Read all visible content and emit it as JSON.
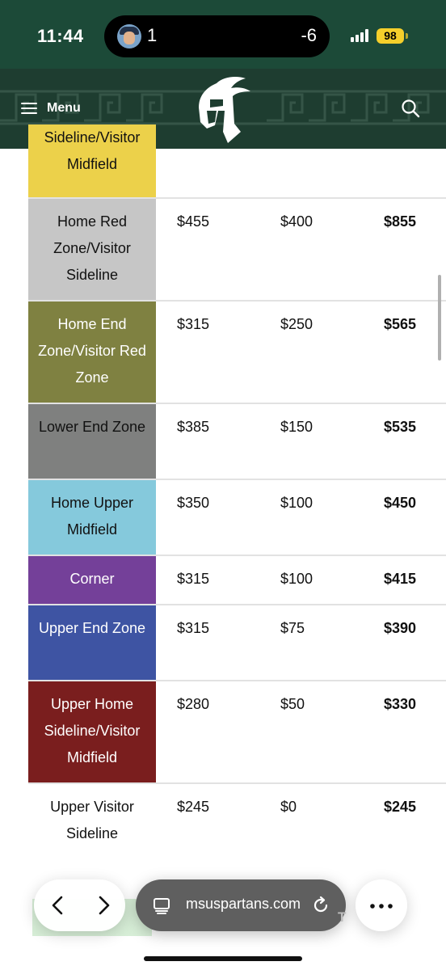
{
  "status_bar": {
    "time": "11:44",
    "live_activity_left": "1",
    "live_activity_right": "-6",
    "battery": "98"
  },
  "header": {
    "menu_label": "Menu",
    "logo": "spartan-helmet-logo",
    "search_icon": "search-icon",
    "background_color": "#1e3d30"
  },
  "price_table": {
    "rows": [
      {
        "zone": "Sideline/Visitor Midfield",
        "color": "#ecd14a",
        "text_color": "#111111",
        "price_a": "",
        "price_b": "",
        "total": ""
      },
      {
        "zone": "Home Red Zone/Visitor Sideline",
        "color": "#c6c6c6",
        "text_color": "#111111",
        "price_a": "$455",
        "price_b": "$400",
        "total": "$855"
      },
      {
        "zone": "Home End Zone/Visitor Red Zone",
        "color": "#7f8141",
        "text_color": "#ffffff",
        "price_a": "$315",
        "price_b": "$250",
        "total": "$565"
      },
      {
        "zone": "Lower End Zone",
        "color": "#7f807f",
        "text_color": "#111111",
        "price_a": "$385",
        "price_b": "$150",
        "total": "$535"
      },
      {
        "zone": "Home Upper Midfield",
        "color": "#85c9dc",
        "text_color": "#111111",
        "price_a": "$350",
        "price_b": "$100",
        "total": "$450"
      },
      {
        "zone": "Corner",
        "color": "#744099",
        "text_color": "#ffffff",
        "price_a": "$315",
        "price_b": "$100",
        "total": "$415"
      },
      {
        "zone": "Upper End Zone",
        "color": "#3e54a3",
        "text_color": "#ffffff",
        "price_a": "$315",
        "price_b": "$75",
        "total": "$390"
      },
      {
        "zone": "Upper Home Sideline/Visitor Midfield",
        "color": "#7a1e1e",
        "text_color": "#ffffff",
        "price_a": "$280",
        "price_b": "$50",
        "total": "$330"
      },
      {
        "zone": "Upper Visitor Sideline",
        "color": "#ffffff",
        "text_color": "#111111",
        "price_a": "$245",
        "price_b": "$0",
        "total": "$245"
      }
    ]
  },
  "browser_bar": {
    "url": "msuspartans.com",
    "back_icon": "chevron-left-icon",
    "forward_icon": "chevron-right-icon",
    "tabs_icon": "tabs-icon",
    "reload_icon": "reload-icon",
    "more_icon": "more-dots-icon"
  }
}
